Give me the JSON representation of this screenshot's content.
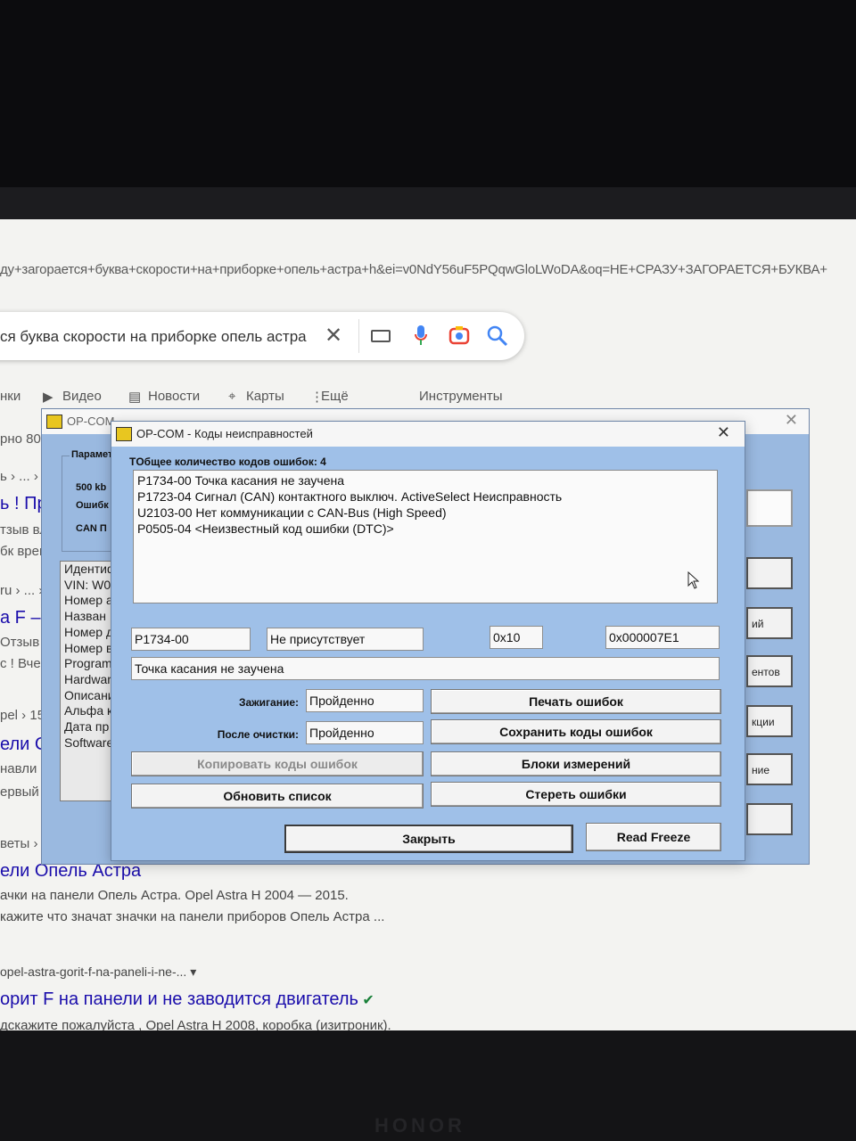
{
  "browser": {
    "url_text": "ду+загорается+буква+скорости+на+приборке+опель+астра+h&ei=v0NdY56uF5PQqwGloLWoDA&oq=НЕ+СРАЗУ+ЗАГОРАЕТСЯ+БУКВА+",
    "search_text": "ся буква скорости на приборке опель астра",
    "nav": {
      "images_partial": "нки",
      "video": "Видео",
      "news": "Новости",
      "maps": "Карты",
      "more": "Ещё",
      "tools": "Инструменты"
    },
    "side_fragments": [
      "рно 80",
      "ь › ... › Бо",
      "ь ! Пр",
      "тзыв вл",
      "бк врем",
      "ru › ... ›",
      "а F –",
      "Отзыв",
      "с ! Вчер",
      "pel › 15",
      "ели С",
      "навли",
      "ервый",
      "веты ›"
    ],
    "results": {
      "title1": "ели Опель Астра",
      "line1": "ачки на панели Опель Астра. Opel Astra H 2004 — 2015.",
      "line2": "кажите что значат значки на панели приборов Опель Астра ...",
      "url2": "opel-astra-gorit-f-na-paneli-i-ne-...",
      "title2": "орит F на панели и не заводится двигатель",
      "line3": "дскажите пожалуйста , Opel Astra H 2008, коробка (изитроник)."
    }
  },
  "background_window": {
    "title": "OP-COM",
    "close": "✕",
    "params_label": "Параметры",
    "params_lines": [
      "500 kb",
      "Ошибк",
      "CAN П"
    ],
    "ident_items": [
      "Идентиф",
      "VIN: W0",
      "Номер a",
      "Назван",
      "Номер д",
      "Номер в",
      "Program",
      "Hardwar",
      "Описани",
      "Альфа к",
      "Дата пр",
      "Software"
    ],
    "right_buttons": [
      "",
      "ий",
      "ентов",
      "кции",
      "ние",
      ""
    ]
  },
  "dialog": {
    "title": "OP-COM - Коды неисправностей",
    "close": "✕",
    "count_label": "Общее количество кодов ошибок: 4",
    "count_prefix": "T",
    "codes": [
      "P1734-00 Точка касания не заучена",
      "P1723-04 Сигнал (CAN) контактного выключ. ActiveSelect Неисправность",
      "U2103-00 Нет коммуникации с  CAN-Bus (High Speed)",
      "P0505-04 <Неизвестный код ошибки (DTC)>"
    ],
    "selected_code": "P1734-00",
    "status": "Не присутствует",
    "hex1": "0x10",
    "hex2": "0x000007E1",
    "description": "Точка касания не заучена",
    "ignition_label": "Зажигание:",
    "ignition_value": "Пройденно",
    "after_clear_label": "После очистки:",
    "after_clear_value": "Пройденно",
    "buttons": {
      "print": "Печать ошибок",
      "save": "Сохранить коды ошибок",
      "copy": "Копировать коды ошибок",
      "measure": "Блоки измерений",
      "refresh": "Обновить список",
      "erase": "Стереть ошибки",
      "close": "Закрыть",
      "freeze": "Read Freeze"
    }
  },
  "device_brand": "HONOR"
}
